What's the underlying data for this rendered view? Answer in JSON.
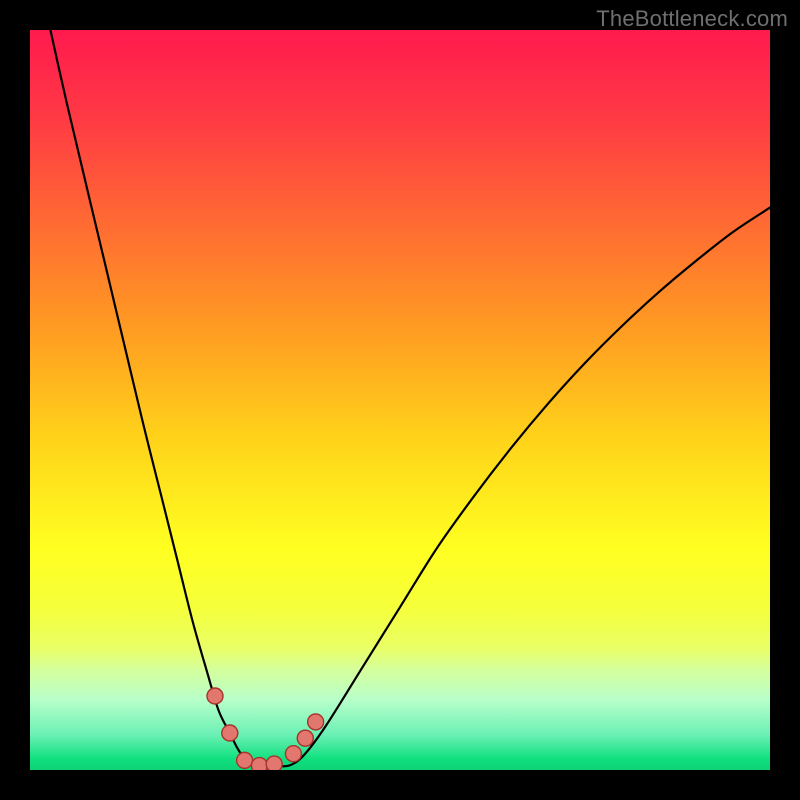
{
  "watermark": "TheBottleneck.com",
  "colors": {
    "frame": "#000000",
    "curve_stroke": "#000000",
    "marker_fill": "#e2776f",
    "marker_stroke": "#a6342b",
    "gradient_stops": [
      {
        "offset": 0.0,
        "color": "#ff1a4e"
      },
      {
        "offset": 0.12,
        "color": "#ff3a44"
      },
      {
        "offset": 0.26,
        "color": "#ff6a33"
      },
      {
        "offset": 0.4,
        "color": "#ff9a22"
      },
      {
        "offset": 0.55,
        "color": "#ffd21a"
      },
      {
        "offset": 0.7,
        "color": "#ffff20"
      },
      {
        "offset": 0.78,
        "color": "#f5ff3a"
      },
      {
        "offset": 0.835,
        "color": "#eaff66"
      },
      {
        "offset": 0.863,
        "color": "#d6ff9a"
      },
      {
        "offset": 0.905,
        "color": "#b8ffca"
      },
      {
        "offset": 0.953,
        "color": "#6af0b4"
      },
      {
        "offset": 0.985,
        "color": "#10e07e"
      },
      {
        "offset": 1.0,
        "color": "#0dd276"
      }
    ]
  },
  "chart_data": {
    "type": "line",
    "title": "",
    "xlabel": "",
    "ylabel": "",
    "xlim": [
      0,
      100
    ],
    "ylim": [
      0,
      100
    ],
    "grid": false,
    "series": [
      {
        "name": "bottleneck-curve",
        "x": [
          1,
          5,
          10,
          15,
          18,
          20,
          22,
          24,
          25.5,
          27,
          28,
          29,
          30,
          33,
          35,
          37,
          40,
          45,
          50,
          55,
          60,
          65,
          70,
          75,
          80,
          85,
          90,
          95,
          100
        ],
        "y": [
          108,
          90,
          69,
          48,
          36,
          28,
          20,
          13,
          8,
          5,
          3,
          1.5,
          0.6,
          0.6,
          0.6,
          2,
          6,
          14,
          22,
          30,
          37,
          43.5,
          49.5,
          55,
          60,
          64.6,
          68.8,
          72.7,
          76
        ]
      }
    ],
    "markers": [
      {
        "x": 25.0,
        "y": 10.0
      },
      {
        "x": 27.0,
        "y": 5.0
      },
      {
        "x": 29.0,
        "y": 1.3
      },
      {
        "x": 31.0,
        "y": 0.6
      },
      {
        "x": 33.0,
        "y": 0.8
      },
      {
        "x": 35.6,
        "y": 2.2
      },
      {
        "x": 37.2,
        "y": 4.3
      },
      {
        "x": 38.6,
        "y": 6.5
      }
    ]
  }
}
